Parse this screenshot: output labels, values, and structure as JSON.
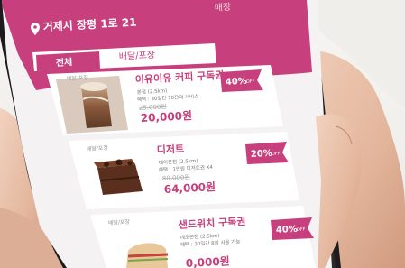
{
  "header": {
    "location": "거제시 장평 1로 21",
    "location_icon": "location-pin-icon",
    "tab_peek": "매장"
  },
  "tabs": [
    {
      "label": "전체",
      "active": true
    },
    {
      "label": "배달/포장",
      "active": false
    }
  ],
  "products": [
    {
      "tag": "배달/포장",
      "name": "이유이유 커피 구독권",
      "detail_1": "본점 (2.5km)",
      "detail_2": "혜택 : 30일간 10잔의 서비스",
      "old_price": "25,000원",
      "price": "20,000원",
      "discount": "40%",
      "discount_suffix": "OFF"
    },
    {
      "tag": "배달/포장",
      "name": "디저트",
      "detail_1": "데이본점 (2.5km)",
      "detail_2": "혜택 : 1만원 디저트권 X4",
      "old_price": "80,000원",
      "price": "64,000원",
      "discount": "20%",
      "discount_suffix": "OFF"
    },
    {
      "tag": "배달/포장",
      "name": "샌드위치 구독권",
      "detail_1": "데오본점 (2.5km)",
      "detail_2": "혜택 : 30일간 8회 사용 가능",
      "old_price": "",
      "price": "0,000원",
      "discount": "40%",
      "discount_suffix": "OFF"
    }
  ],
  "colors": {
    "brand": "#c73f7c",
    "brand_dark": "#a9306a",
    "phone_body": "#1d1b1e",
    "skin": "#e9c3ad",
    "background": "#f3f1ee"
  }
}
